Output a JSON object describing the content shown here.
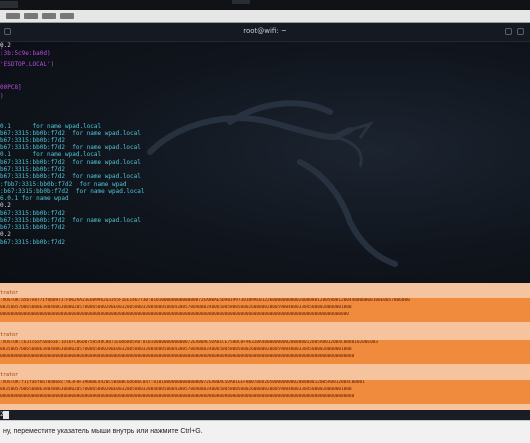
{
  "window": {
    "title": "root@wifi: ~"
  },
  "terminal_lines": [
    {
      "text": ")",
      "color": "purple"
    },
    {
      "text": ":3b:5c9e:ba0d)",
      "color": "purple"
    },
    {
      "text": "'ESDTOP.LOCAL')",
      "color": "purple"
    },
    {
      "text": "00PC8]",
      "color": "purple"
    },
    {
      "text": ")",
      "color": "purple"
    },
    {
      "text": "0.1      for name wpad.local",
      "color": "cyan"
    },
    {
      "text": "b67:3315:bb0b:f7d2  for name wpad.local",
      "color": "cyan"
    },
    {
      "text": "b67:3315:bb0b:f7d2",
      "color": "cyan"
    },
    {
      "text": "b67:3315:bb0b:f7d2  for name wpad.local",
      "color": "cyan"
    },
    {
      "text": "0.1      for name wpad.local",
      "color": "cyan"
    },
    {
      "text": "b67:3315:bb0b:f7d2  for name wpad.local",
      "color": "cyan"
    },
    {
      "text": "b67:3315:bb0b:f7d2",
      "color": "cyan"
    },
    {
      "text": "b67:3315:bb0b:f7d2  for name wpad.local",
      "color": "cyan"
    },
    {
      "text": ":fbb7:3315:bb0b:f7d2  for name wpad",
      "color": "cyan"
    },
    {
      "text": ":b67:3315:bb0b:f7d2  for name wpad.local",
      "color": "cyan"
    },
    {
      "text": "6.0.1 for name wpad",
      "color": "cyan"
    },
    {
      "text": "0.2",
      "color": "white"
    },
    {
      "text": "b67:3315:bb0b:f7d2",
      "color": "cyan"
    },
    {
      "text": "b67:3315:bb0b:f7d2  for name wpad.local",
      "color": "cyan"
    },
    {
      "text": "b67:3315:bb0b:f7d2",
      "color": "cyan"
    },
    {
      "text": "0.2",
      "color": "white"
    },
    {
      "text": "b67:3315:bb0b:f7d2",
      "color": "cyan"
    },
    {
      "text": "0.2",
      "color": "white"
    }
  ],
  "hash_blocks": [
    {
      "title": "trator",
      "lines": [
        ":VOSTOK:a5b7e8771fdb0971:FD62AA23E609962a3355F1EE1467730:01010000000000000072EA80AE5DA01997301B9AE0122600000000002000080120058001200440000000100E0057006800",
        "0035005700650006300400630000205700065000200E003200580032004D005800430057004B0034006500580050002600000200059004B0033045000020000001800",
        "000000000000000000000000000000000000000000000000000000000000000000000000000000000000000000000000000000000000000000000000000000000000"
      ]
    },
    {
      "title": "trator",
      "lines": [
        ":VOSTOK:c631c6afa0deab:1D16FC06D0758548C8071E0D6805A0:0101000000000000072EA80AE5DA01CE7580C0F9632BA4000000000200008012005A0012004C000010200E003",
        "0035005700650006300400630000205700065000200E003200580032004D005800430057004B0034006500580050002600000200059004B0033045000020000001800",
        "00000000000000000000000000000000000000000000000000000000000000000000000000000000000000000000000000000000000000000000000000000000000000"
      ]
    },
    {
      "title": "trator",
      "lines": [
        ":VOSTOK:f11fa6f6b78d068c:9E3F8F39B8BE4420C5B4B0C6D6B6C047:010100000000000000072EA80AE5DA01EEF8B07BDD2D5000000000200008012005A0012004C00001",
        "0035005700650006300400630000205700065000200E003200580032004D005800430057004B0034006500580050002600000200059004B0033045000020000001800",
        "00000000000000000000000000000000000000000000000000000000000000000000000000000000000000000000000000000000000000000000000000000000000000"
      ]
    }
  ],
  "prompt": {
    "text": "2"
  },
  "status_bar": {
    "message": "ну, переместите указатель мыши внутрь или нажмите Ctrl+G."
  },
  "colors": {
    "purple": "#b54ce0",
    "cyan": "#4fc5d8",
    "white": "#d7dbe2",
    "hash_highlight": "#f08a3c",
    "hash_region": "#f5c39d"
  }
}
